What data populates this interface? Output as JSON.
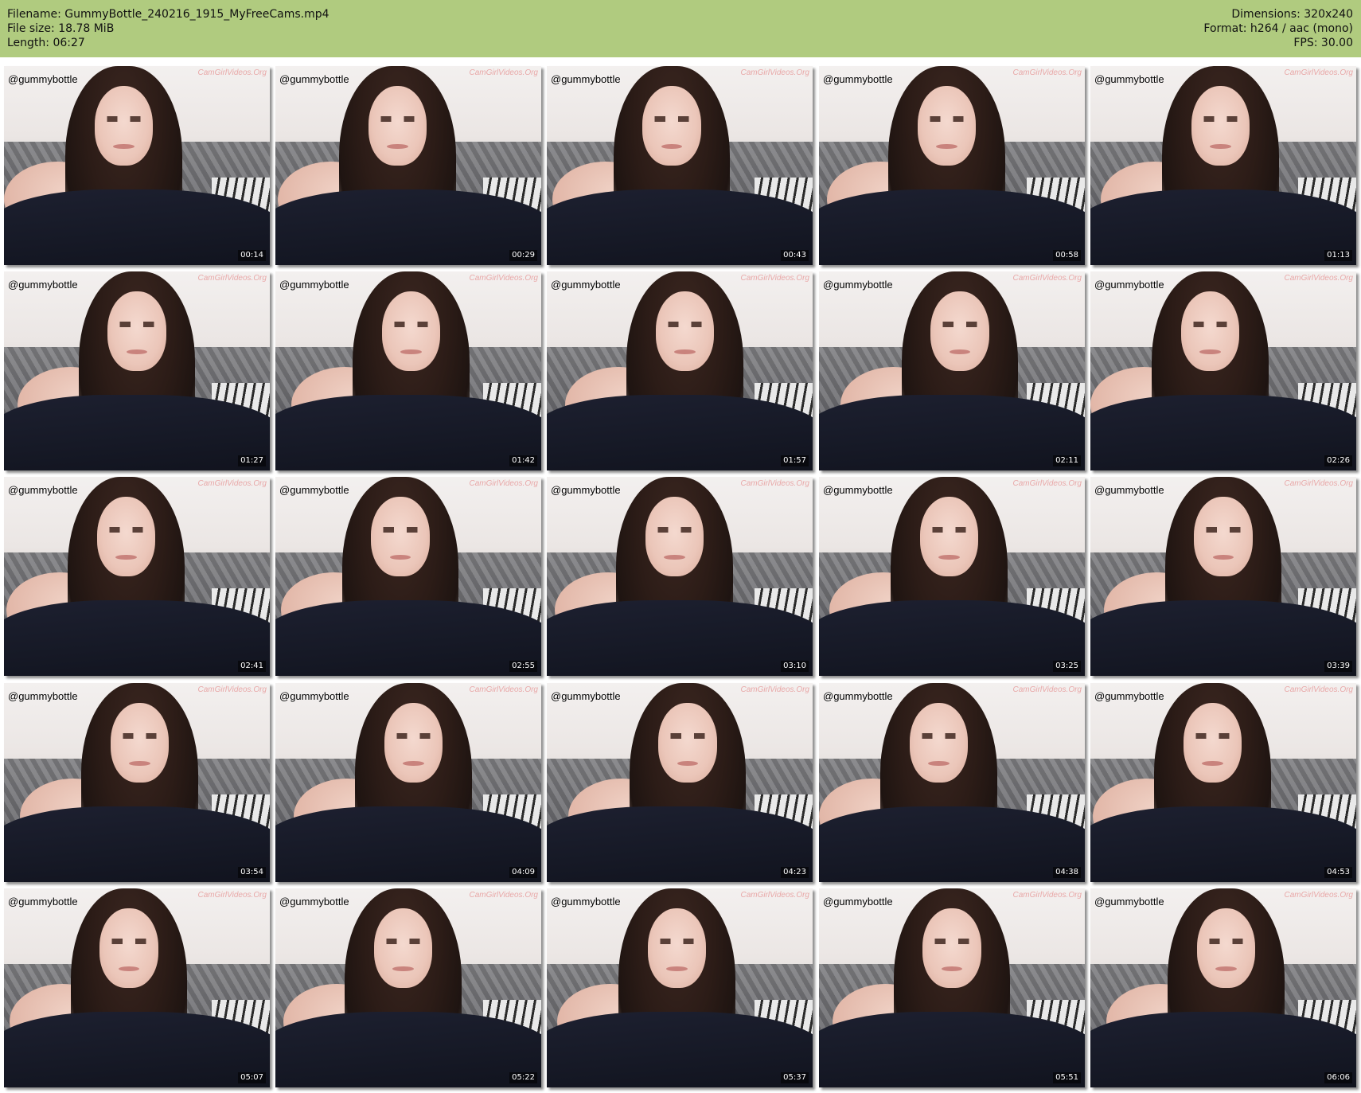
{
  "header": {
    "filename": "Filename: GummyBottle_240216_1915_MyFreeCams.mp4",
    "file_size": "File size: 18.78 MiB",
    "length": "Length: 06:27",
    "dimensions": "Dimensions: 320x240",
    "format": "Format: h264 / aac (mono)",
    "fps": "FPS: 30.00"
  },
  "thumb_overlay": {
    "username": "@gummybottle",
    "watermark": "CamGirlVideos.Org"
  },
  "thumbnails": [
    {
      "time": "00:14"
    },
    {
      "time": "00:29"
    },
    {
      "time": "00:43"
    },
    {
      "time": "00:58"
    },
    {
      "time": "01:13"
    },
    {
      "time": "01:27"
    },
    {
      "time": "01:42"
    },
    {
      "time": "01:57"
    },
    {
      "time": "02:11"
    },
    {
      "time": "02:26"
    },
    {
      "time": "02:41"
    },
    {
      "time": "02:55"
    },
    {
      "time": "03:10"
    },
    {
      "time": "03:25"
    },
    {
      "time": "03:39"
    },
    {
      "time": "03:54"
    },
    {
      "time": "04:09"
    },
    {
      "time": "04:23"
    },
    {
      "time": "04:38"
    },
    {
      "time": "04:53"
    },
    {
      "time": "05:07"
    },
    {
      "time": "05:22"
    },
    {
      "time": "05:37"
    },
    {
      "time": "05:51"
    },
    {
      "time": "06:06"
    }
  ],
  "colors": {
    "header_bg": "#b0cb7f",
    "timestamp_bg": "#000000",
    "watermark": "#e79b9b"
  }
}
